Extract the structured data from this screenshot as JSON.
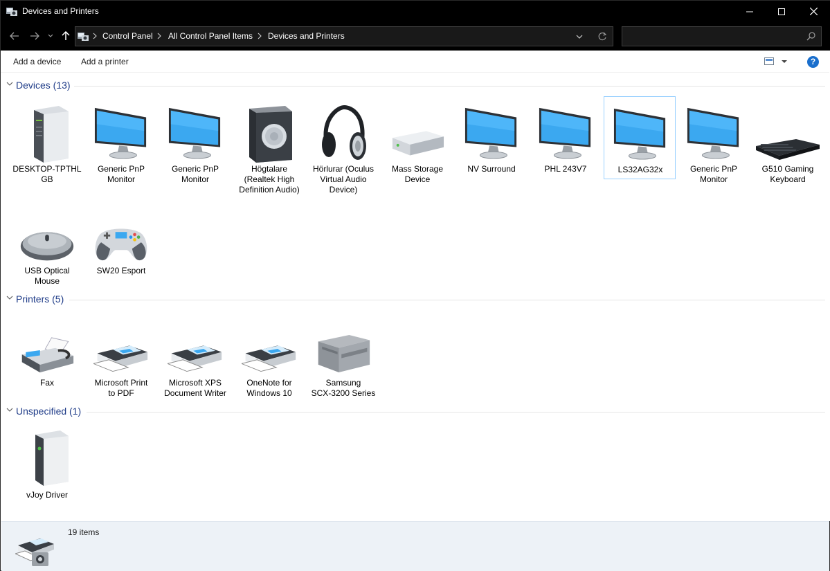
{
  "window": {
    "title": "Devices and Printers",
    "app_icon": "devices-printers-icon"
  },
  "window_controls": {
    "minimize": "minimize-icon",
    "maximize": "maximize-icon",
    "close": "close-icon"
  },
  "breadcrumbs": [
    "Control Panel",
    "All Control Panel Items",
    "Devices and Printers"
  ],
  "search": {
    "placeholder": ""
  },
  "commands": {
    "add_device": "Add a device",
    "add_printer": "Add a printer",
    "help": "?"
  },
  "groups": {
    "devices": {
      "label": "Devices (13)",
      "items": [
        {
          "label": "DESKTOP-TPTHL\nGB",
          "icon": "pc-tower-icon"
        },
        {
          "label": "Generic PnP\nMonitor",
          "icon": "monitor-icon"
        },
        {
          "label": "Generic PnP\nMonitor",
          "icon": "monitor-icon"
        },
        {
          "label": "Högtalare\n(Realtek High\nDefinition Audio)",
          "icon": "speaker-icon"
        },
        {
          "label": "Hörlurar (Oculus\nVirtual Audio\nDevice)",
          "icon": "headphones-icon"
        },
        {
          "label": "Mass Storage\nDevice",
          "icon": "storage-drive-icon"
        },
        {
          "label": "NV Surround",
          "icon": "monitor-icon"
        },
        {
          "label": "PHL 243V7",
          "icon": "monitor-icon"
        },
        {
          "label": "LS32AG32x",
          "icon": "monitor-icon",
          "selected": true
        },
        {
          "label": "Generic PnP\nMonitor",
          "icon": "monitor-icon"
        },
        {
          "label": "G510 Gaming\nKeyboard",
          "icon": "keyboard-icon"
        },
        {
          "label": "USB Optical\nMouse",
          "icon": "mouse-icon"
        },
        {
          "label": "SW20 Esport",
          "icon": "gamepad-icon"
        }
      ]
    },
    "printers": {
      "label": "Printers (5)",
      "items": [
        {
          "label": "Fax",
          "icon": "fax-icon"
        },
        {
          "label": "Microsoft Print\nto PDF",
          "icon": "printer-icon"
        },
        {
          "label": "Microsoft XPS\nDocument Writer",
          "icon": "printer-icon"
        },
        {
          "label": "OneNote for\nWindows 10",
          "icon": "printer-icon"
        },
        {
          "label": "Samsung\nSCX-3200 Series",
          "icon": "laser-printer-icon"
        }
      ]
    },
    "unspecified": {
      "label": "Unspecified (1)",
      "items": [
        {
          "label": "vJoy Driver",
          "icon": "generic-device-icon"
        }
      ]
    }
  },
  "status": {
    "count": "19 items"
  },
  "colors": {
    "accent": "#1f3c88",
    "selection_border": "#99d1ff",
    "monitor_screen": "#3ba8f0",
    "details_bg": "#edf2f7"
  }
}
